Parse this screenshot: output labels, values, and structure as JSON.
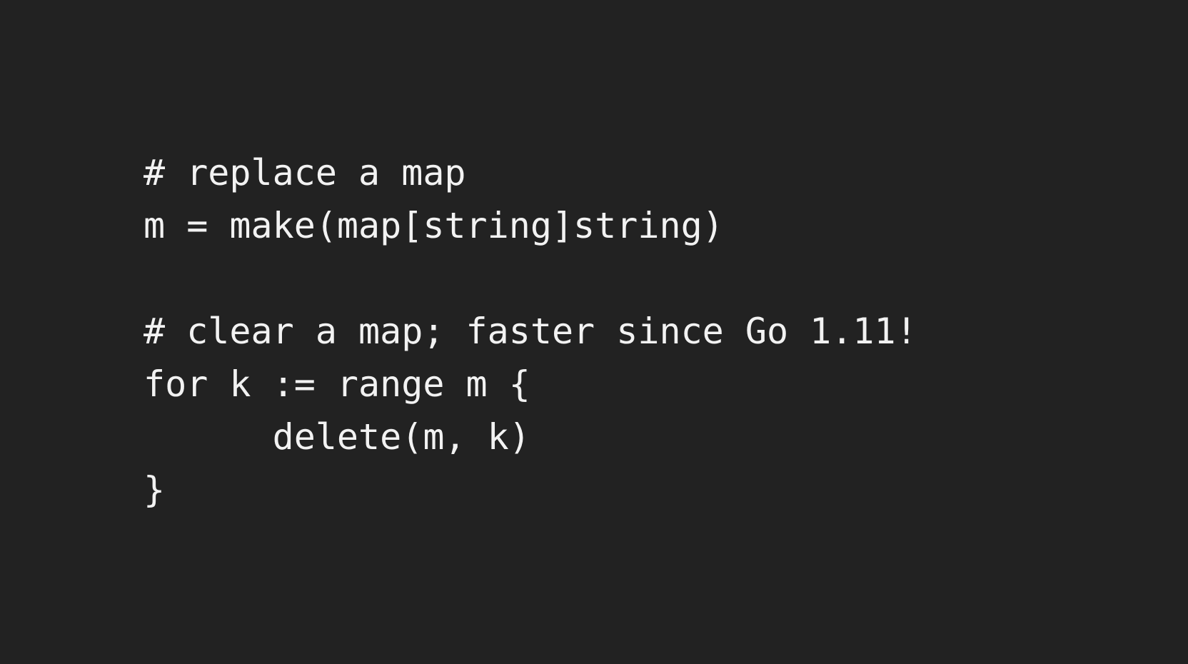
{
  "theme": {
    "background": "#222222",
    "text_color": "#f2f2f2"
  },
  "code": {
    "lines": [
      "# replace a map",
      "m = make(map[string]string)",
      "",
      "# clear a map; faster since Go 1.11!",
      "for k := range m {",
      "      delete(m, k)",
      "}"
    ]
  }
}
